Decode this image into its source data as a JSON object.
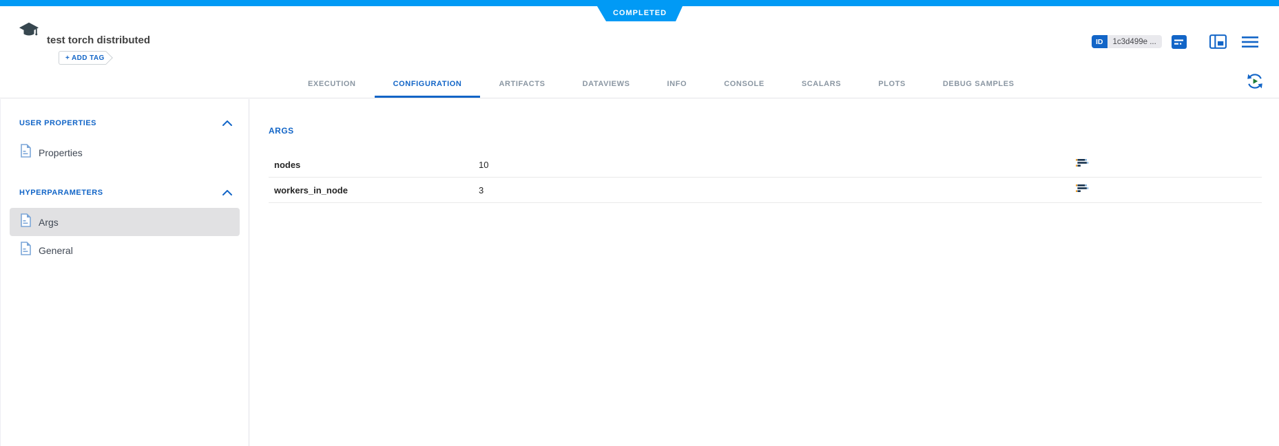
{
  "colors": {
    "primary_blue": "#019af5",
    "action_blue": "#1265c7"
  },
  "header": {
    "experiment_title": "test torch distributed",
    "add_tag_label": "+ ADD TAG",
    "status_badge": "COMPLETED",
    "id_badge_label": "ID",
    "id_value": "1c3d499e ..."
  },
  "tabs": {
    "items": [
      {
        "label": "EXECUTION"
      },
      {
        "label": "CONFIGURATION",
        "active": true
      },
      {
        "label": "ARTIFACTS"
      },
      {
        "label": "DATAVIEWS"
      },
      {
        "label": "INFO"
      },
      {
        "label": "CONSOLE"
      },
      {
        "label": "SCALARS"
      },
      {
        "label": "PLOTS"
      },
      {
        "label": "DEBUG SAMPLES"
      }
    ]
  },
  "sidebar": {
    "sections": [
      {
        "title": "USER PROPERTIES",
        "items": [
          {
            "label": "Properties",
            "selected": false
          }
        ]
      },
      {
        "title": "HYPERPARAMETERS",
        "items": [
          {
            "label": "Args",
            "selected": true
          },
          {
            "label": "General",
            "selected": false
          }
        ]
      }
    ]
  },
  "main": {
    "section_title": "ARGS",
    "params": [
      {
        "name": "nodes",
        "value": "10"
      },
      {
        "name": "workers_in_node",
        "value": "3"
      }
    ]
  }
}
